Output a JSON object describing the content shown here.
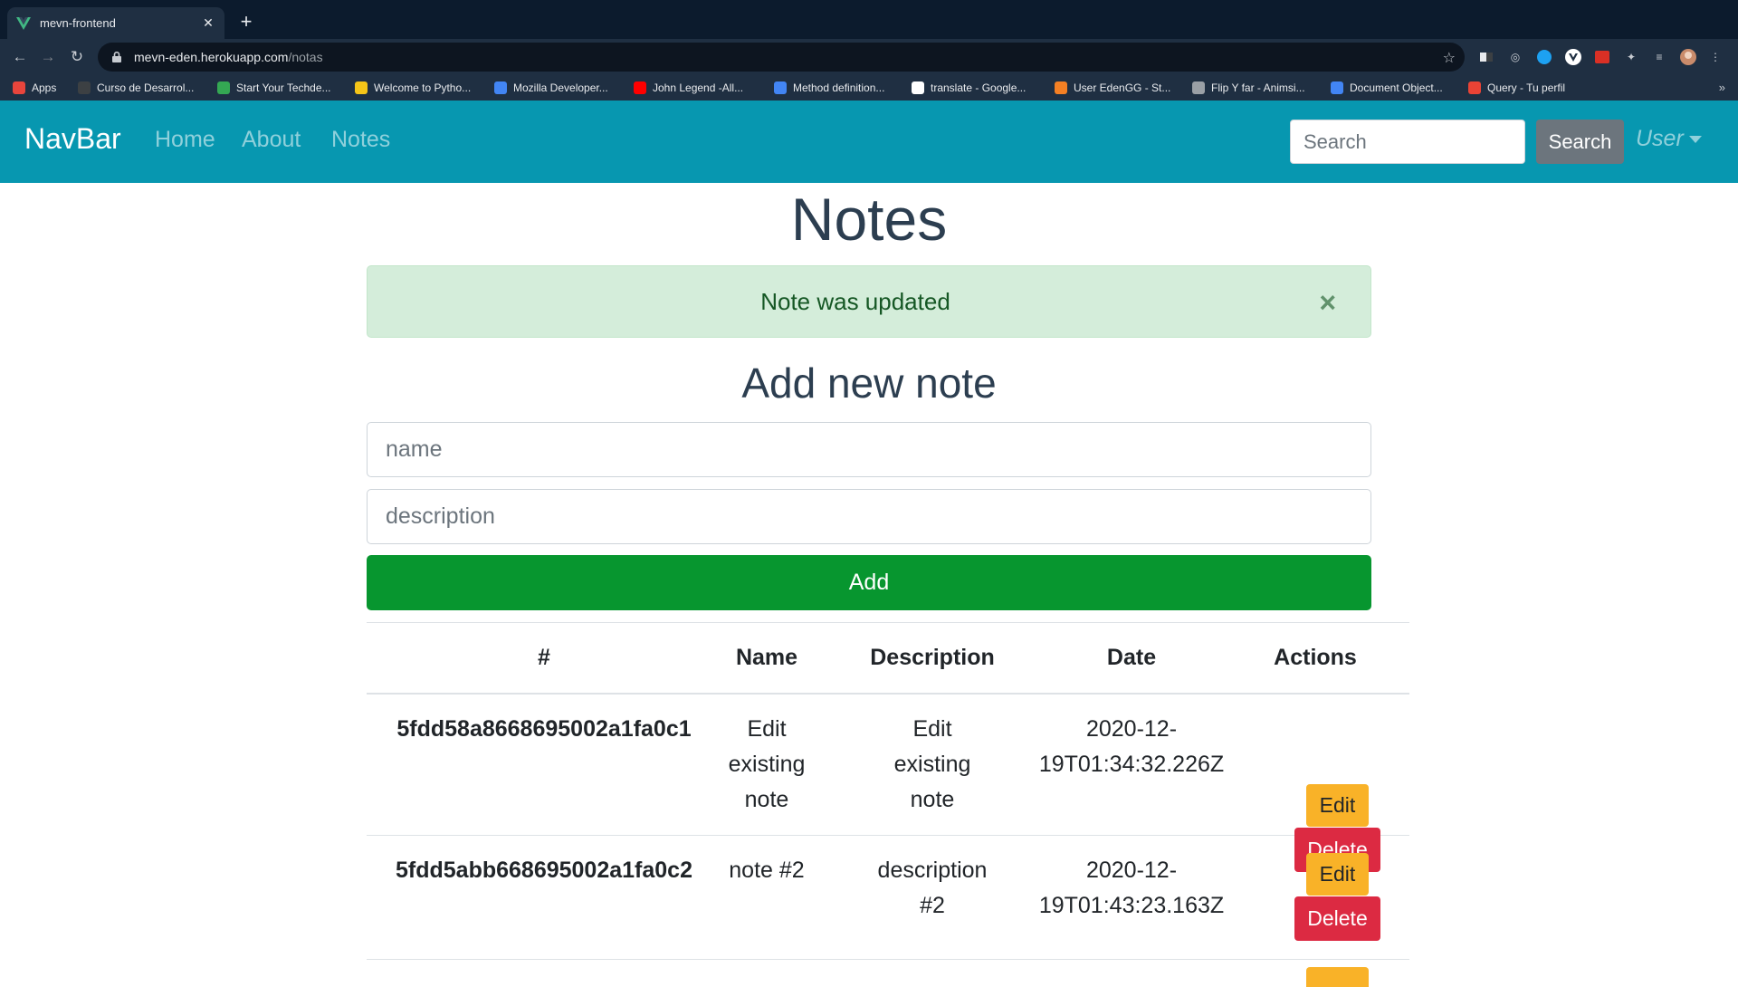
{
  "browser": {
    "tab_title": "mevn-frontend",
    "url_host": "mevn-eden.herokuapp.com",
    "url_path": "/notas",
    "bookmarks": [
      {
        "label": "Apps",
        "color": "#e8453c"
      },
      {
        "label": "Curso de Desarrol...",
        "color": "#3c4043"
      },
      {
        "label": "Start Your Techde...",
        "color": "#34a853"
      },
      {
        "label": "Welcome to Pytho...",
        "color": "#f5c518"
      },
      {
        "label": "Mozilla Developer...",
        "color": "#4285f4"
      },
      {
        "label": "John Legend -All...",
        "color": "#ff0000"
      },
      {
        "label": "Method definition...",
        "color": "#4285f4"
      },
      {
        "label": "translate - Google...",
        "color": "#ffffff"
      },
      {
        "label": "User EdenGG - St...",
        "color": "#f48024"
      },
      {
        "label": "Flip Y far - Animsi...",
        "color": "#9aa0a6"
      },
      {
        "label": "Document Object...",
        "color": "#4285f4"
      },
      {
        "label": "Query - Tu perfil",
        "color": "#ea4335"
      }
    ],
    "more_label": "»"
  },
  "navbar": {
    "brand": "NavBar",
    "links": [
      "Home",
      "About",
      "Notes"
    ],
    "search_placeholder": "Search",
    "search_button": "Search",
    "user_label": "User",
    "color": "#0797b0"
  },
  "page": {
    "title": "Notes",
    "alert_text": "Note was updated",
    "alert_close": "×",
    "form_title": "Add new note",
    "name_placeholder": "name",
    "description_placeholder": "description",
    "add_button": "Add"
  },
  "table": {
    "headers": [
      "#",
      "Name",
      "Description",
      "Date",
      "Actions"
    ],
    "rows": [
      {
        "id": "5fdd58a8668695002a1fa0c1",
        "name_lines": [
          "Edit",
          "existing",
          "note"
        ],
        "description_lines": [
          "Edit",
          "existing",
          "note"
        ],
        "date_lines": [
          "2020-12-",
          "19T01:34:32.226Z"
        ],
        "edit": "Edit",
        "delete": "Delete"
      },
      {
        "id": "5fdd5abb668695002a1fa0c2",
        "name_lines": [
          "note #2"
        ],
        "description_lines": [
          "description",
          "#2"
        ],
        "date_lines": [
          "2020-12-",
          "19T01:43:23.163Z"
        ],
        "edit": "Edit",
        "delete": "Delete"
      }
    ]
  }
}
